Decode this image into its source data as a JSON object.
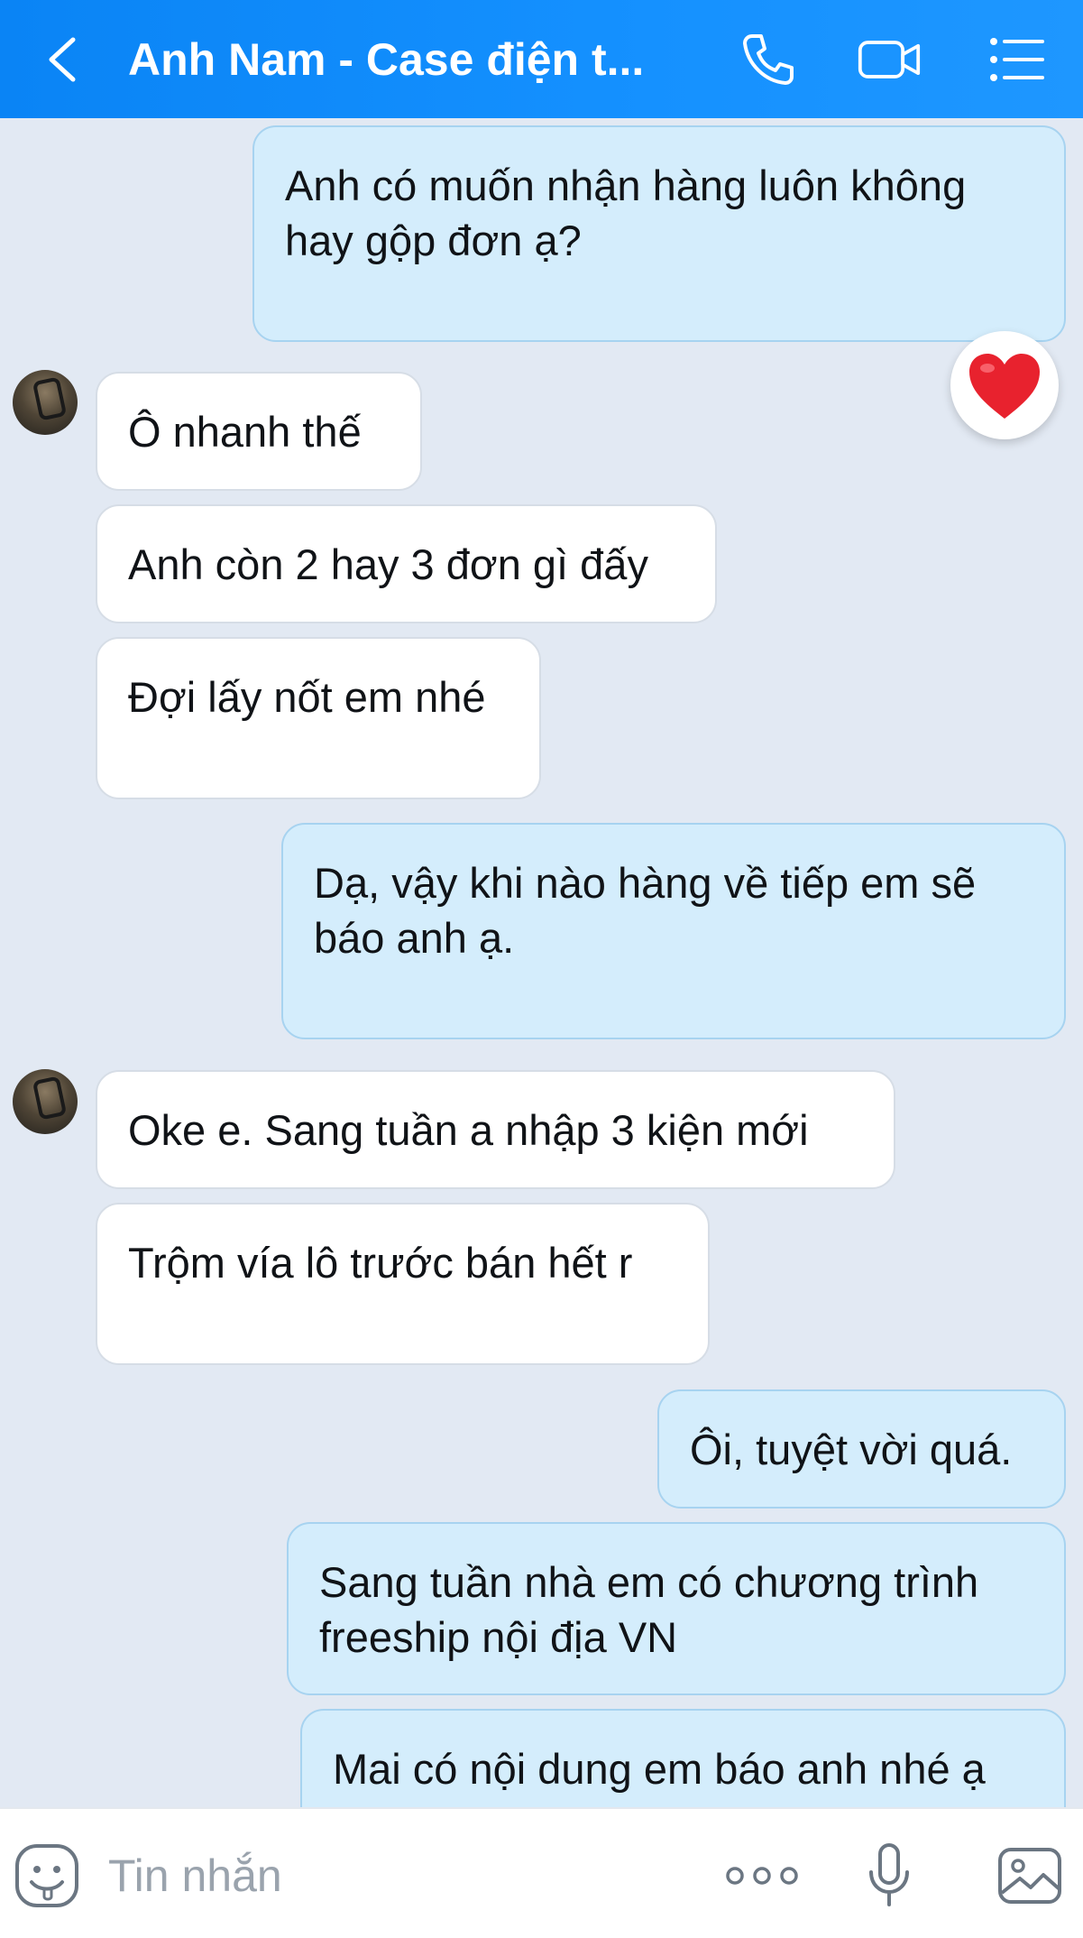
{
  "header": {
    "title": "Anh Nam - Case điện t...",
    "back_icon": "chevron-left-icon",
    "call_icon": "phone-icon",
    "video_icon": "video-camera-icon",
    "menu_icon": "list-menu-icon",
    "background_color": "#0a84f5"
  },
  "messages": [
    {
      "direction": "out",
      "text": "Anh có muốn nhận hàng luôn không\nhay gộp đơn ạ?",
      "reaction": "heart"
    },
    {
      "direction": "in",
      "text": "Ô nhanh thế",
      "avatar": true
    },
    {
      "direction": "in",
      "text": "Anh còn 2 hay 3 đơn gì đấy"
    },
    {
      "direction": "in",
      "text": "Đợi lấy nốt em nhé"
    },
    {
      "direction": "out",
      "text": "Dạ, vậy khi nào hàng về tiếp em sẽ\nbáo anh ạ."
    },
    {
      "direction": "in",
      "text": "Oke e. Sang tuần a nhập 3 kiện mới",
      "avatar": true
    },
    {
      "direction": "in",
      "text": "Trộm vía lô trước bán hết r"
    },
    {
      "direction": "out",
      "text": "Ôi, tuyệt vời quá."
    },
    {
      "direction": "out",
      "text": "Sang tuần nhà em có chương trình\nfreeship nội địa VN"
    },
    {
      "direction": "out",
      "text": "Mai có nội dung em báo anh nhé ạ"
    }
  ],
  "input": {
    "placeholder": "Tin nhắn",
    "emoji_icon": "emoji-icon",
    "more_icon": "more-dots-icon",
    "mic_icon": "microphone-icon",
    "gallery_icon": "image-gallery-icon"
  },
  "colors": {
    "background": "#e2e9f3",
    "outgoing_bubble": "#d4edfc",
    "incoming_bubble": "#ffffff",
    "reaction_heart": "#e8222e"
  }
}
